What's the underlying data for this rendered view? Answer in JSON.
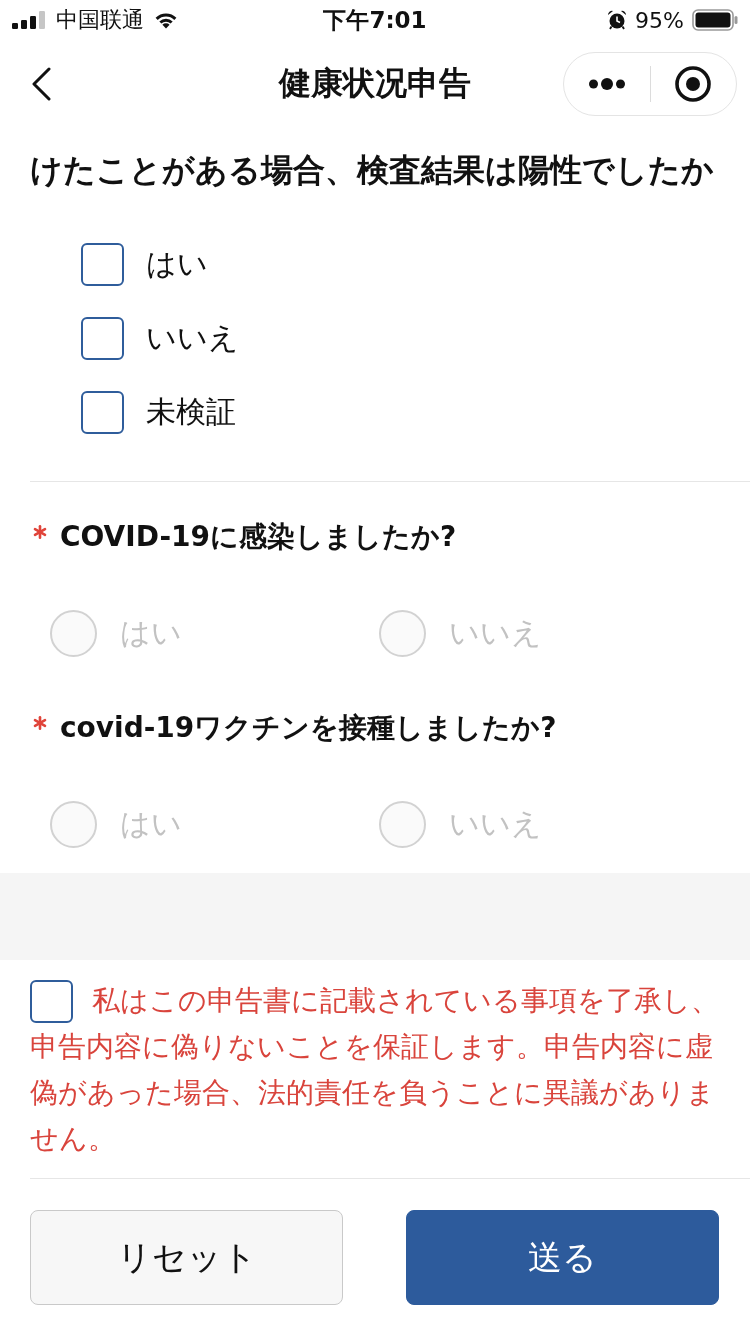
{
  "status_bar": {
    "carrier": "中国联通",
    "time": "下午7:01",
    "battery": "95%"
  },
  "nav_bar": {
    "title": "健康状况申告"
  },
  "questions": [
    {
      "kind": "checkbox",
      "required": false,
      "text": "けたことがある場合、検査結果は陽性でしたか",
      "options": [
        {
          "label": "はい",
          "checked": false
        },
        {
          "label": "いいえ",
          "checked": false
        },
        {
          "label": "未検証",
          "checked": false
        }
      ]
    },
    {
      "kind": "radio",
      "required": true,
      "text": "COVID-19に感染しましたか?",
      "options": [
        {
          "label": "はい",
          "selected": false,
          "disabled": true
        },
        {
          "label": "いいえ",
          "selected": false,
          "disabled": true
        }
      ]
    },
    {
      "kind": "radio",
      "required": true,
      "text": "covid-19ワクチンを接種しましたか?",
      "options": [
        {
          "label": "はい",
          "selected": false,
          "disabled": true
        },
        {
          "label": "いいえ",
          "selected": false,
          "disabled": true
        }
      ]
    }
  ],
  "consent": {
    "checked": false,
    "text": "私はこの申告書に記載されている事項を了承し、申告内容に偽りないことを保証します。申告内容に虚偽があった場合、法的責任を負うことに異議がありません。"
  },
  "buttons": [
    {
      "kind": "secondary",
      "label": "リセット"
    },
    {
      "kind": "primary",
      "label": "送る"
    }
  ]
}
